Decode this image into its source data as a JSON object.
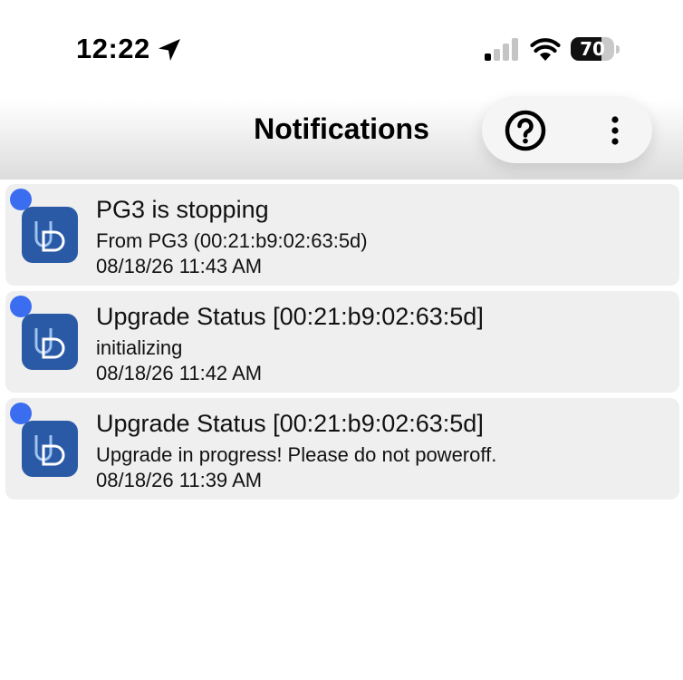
{
  "status_bar": {
    "time": "12:22",
    "location_icon": "location-arrow-icon",
    "signal_icon": "cellular-signal-icon",
    "wifi_icon": "wifi-icon",
    "battery_level": "70",
    "battery_fraction": 0.7
  },
  "header": {
    "title": "Notifications",
    "help_icon": "help-circle-icon",
    "more_icon": "more-vertical-icon"
  },
  "notifications": [
    {
      "title": "PG3 is stopping",
      "body": "From PG3 (00:21:b9:02:63:5d)",
      "time": "08/18/26 11:43 AM",
      "unread": true
    },
    {
      "title": "Upgrade Status [00:21:b9:02:63:5d]",
      "body": "initializing",
      "time": "08/18/26 11:42 AM",
      "unread": true
    },
    {
      "title": "Upgrade Status [00:21:b9:02:63:5d]",
      "body": "Upgrade in progress! Please do not poweroff.",
      "time": "08/18/26 11:39 AM",
      "unread": true
    }
  ],
  "colors": {
    "unread_dot": "#3b6df0",
    "app_logo_bg": "#2a5aa5",
    "card_bg": "#efefef"
  }
}
